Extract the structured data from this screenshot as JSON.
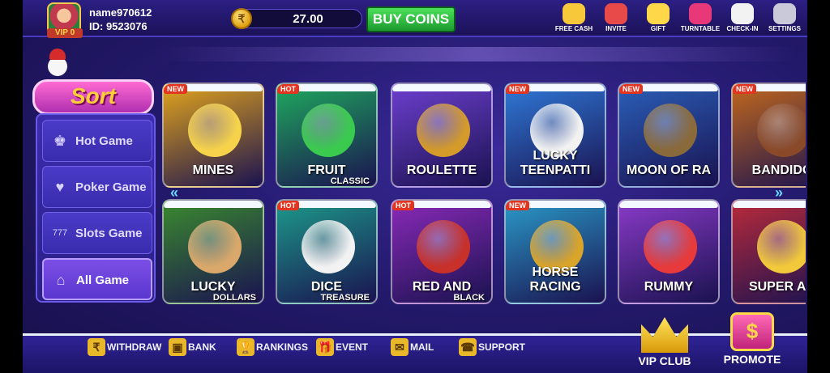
{
  "user": {
    "name": "name970612",
    "id": "ID: 9523076",
    "vip": "VIP 0"
  },
  "balance": {
    "value": "27.00",
    "coin_symbol": "₹",
    "buy_label": "BUY COINS"
  },
  "top_icons": [
    {
      "label": "FREE CASH",
      "icon": "free-cash-icon",
      "color": "#f7c93a"
    },
    {
      "label": "INVITE",
      "icon": "invite-icon",
      "color": "#e84a4a"
    },
    {
      "label": "GIFT",
      "icon": "gift-icon",
      "color": "#ffd84a"
    },
    {
      "label": "TURNTABLE",
      "icon": "turntable-icon",
      "color": "#e8387a"
    },
    {
      "label": "CHECK-IN",
      "icon": "check-in-icon",
      "color": "#f2f2f2"
    },
    {
      "label": "SETTINGS",
      "icon": "settings-icon",
      "color": "#c9c9d9"
    }
  ],
  "sort": {
    "title": "Sort",
    "items": [
      {
        "label": "Hot Game",
        "icon": "hot-game-icon",
        "glyph": "♚"
      },
      {
        "label": "Poker Game",
        "icon": "poker-game-icon",
        "glyph": "♥"
      },
      {
        "label": "Slots Game",
        "icon": "slots-game-icon",
        "glyph": "777"
      },
      {
        "label": "All Game",
        "icon": "all-game-icon",
        "glyph": "⌂"
      }
    ],
    "active": "All Game"
  },
  "games": [
    {
      "name": "MINES",
      "sub": "",
      "tag": "NEW",
      "bg": "#e3a51c",
      "art": "#f6d34a"
    },
    {
      "name": "FRUIT",
      "sub": "CLASSIC",
      "tag": "HOT",
      "bg": "#1faa5e",
      "art": "#3acb4e"
    },
    {
      "name": "ROULETTE",
      "sub": "",
      "tag": "",
      "bg": "#6d3fcf",
      "art": "#d49a2a"
    },
    {
      "name": "LUCKY TEENPATTI",
      "sub": "",
      "tag": "NEW",
      "bg": "#2f7ad8",
      "art": "#f2f2f2"
    },
    {
      "name": "MOON OF RA",
      "sub": "",
      "tag": "NEW",
      "bg": "#2a5fb8",
      "art": "#8a6a3a"
    },
    {
      "name": "BANDIDO",
      "sub": "",
      "tag": "NEW",
      "bg": "#c2681c",
      "art": "#8a4a2a"
    },
    {
      "name": "LUCKY",
      "sub": "DOLLARS",
      "tag": "",
      "bg": "#3a8a2e",
      "art": "#d9a86a"
    },
    {
      "name": "DICE",
      "sub": "TREASURE",
      "tag": "HOT",
      "bg": "#1c9a8a",
      "art": "#f2f2f2"
    },
    {
      "name": "RED AND",
      "sub": "BLACK",
      "tag": "HOT",
      "bg": "#8a2ab8",
      "art": "#c8302a"
    },
    {
      "name": "HORSE RACING",
      "sub": "",
      "tag": "NEW",
      "bg": "#2a9ac8",
      "art": "#d9a42a"
    },
    {
      "name": "RUMMY",
      "sub": "",
      "tag": "",
      "bg": "#8a3ac8",
      "art": "#e83a3a"
    },
    {
      "name": "SUPER AC",
      "sub": "",
      "tag": "",
      "bg": "#b82a3a",
      "art": "#f2c93a"
    }
  ],
  "bottom": [
    {
      "label": "WITHDRAW",
      "icon": "withdraw-icon",
      "glyph": "₹"
    },
    {
      "label": "BANK",
      "icon": "bank-icon",
      "glyph": "▣"
    },
    {
      "label": "RANKINGS",
      "icon": "rankings-icon",
      "glyph": "🏆"
    },
    {
      "label": "EVENT",
      "icon": "event-icon",
      "glyph": "🎁"
    },
    {
      "label": "MAIL",
      "icon": "mail-icon",
      "glyph": "✉"
    },
    {
      "label": "SUPPORT",
      "icon": "support-icon",
      "glyph": "☎"
    }
  ],
  "vip_club": "VIP CLUB",
  "promote": "PROMOTE"
}
